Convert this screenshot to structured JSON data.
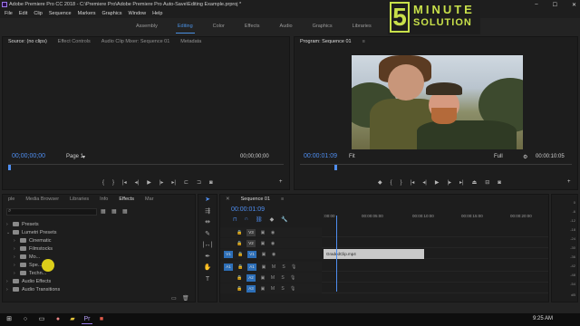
{
  "window": {
    "title": "Adobe Premiere Pro CC 2018 - C:\\Premiere Pro\\Adobe Premiere Pro Auto-Save\\Editing Example.prproj *"
  },
  "menu": [
    "File",
    "Edit",
    "Clip",
    "Sequence",
    "Markers",
    "Graphics",
    "Window",
    "Help"
  ],
  "workspaces": [
    "Assembly",
    "Editing",
    "Color",
    "Effects",
    "Audio",
    "Graphics",
    "Libraries"
  ],
  "workspace_active": "Editing",
  "logo": {
    "line1": "MINUTE",
    "line2": "SOLUTION",
    "number": "5"
  },
  "source": {
    "tabs": [
      "Source: (no clips)",
      "Effect Controls",
      "Audio Clip Mixer: Sequence 01",
      "Metadata"
    ],
    "timecode_left": "00;00;00;00",
    "page": "Page 1",
    "timecode_right": "00;00;00;00"
  },
  "program": {
    "tab": "Program: Sequence 01",
    "timecode_left": "00:00:01:09",
    "fit": "Fit",
    "quality": "Full",
    "timecode_right": "00:00:10:05"
  },
  "effects": {
    "tabs": [
      "ple",
      "Media Browser",
      "Libraries",
      "Info",
      "Effects",
      "Mar"
    ],
    "active_tab": "Effects",
    "tree": [
      {
        "label": "Presets",
        "indent": 0
      },
      {
        "label": "Lumetri Presets",
        "indent": 0
      },
      {
        "label": "Cinematic",
        "indent": 1
      },
      {
        "label": "Filmstocks",
        "indent": 1
      },
      {
        "label": "Mo...",
        "indent": 1
      },
      {
        "label": "Spe...",
        "indent": 1
      },
      {
        "label": "Techn...",
        "indent": 1
      },
      {
        "label": "Audio Effects",
        "indent": 0
      },
      {
        "label": "Audio Transitions",
        "indent": 0
      }
    ]
  },
  "timeline": {
    "tab": "Sequence 01",
    "timecode": "00:00:01:09",
    "ruler": [
      ":00:00",
      "00:00:05:00",
      "00:00:10:00",
      "00:00:15:00",
      "00:00:20:00"
    ],
    "video_tracks": [
      "V3",
      "V2",
      "V1"
    ],
    "audio_tracks": [
      "A1",
      "A2",
      "A3"
    ],
    "clip_label": "GradedClip.mp4",
    "source_patch_v": "V1",
    "source_patch_a": "A1"
  },
  "meter": [
    "0",
    "-6",
    "-12",
    "-18",
    "-24",
    "-30",
    "-36",
    "-42",
    "-48",
    "-54",
    "dB"
  ],
  "taskbar": {
    "time": "9:25 AM"
  }
}
